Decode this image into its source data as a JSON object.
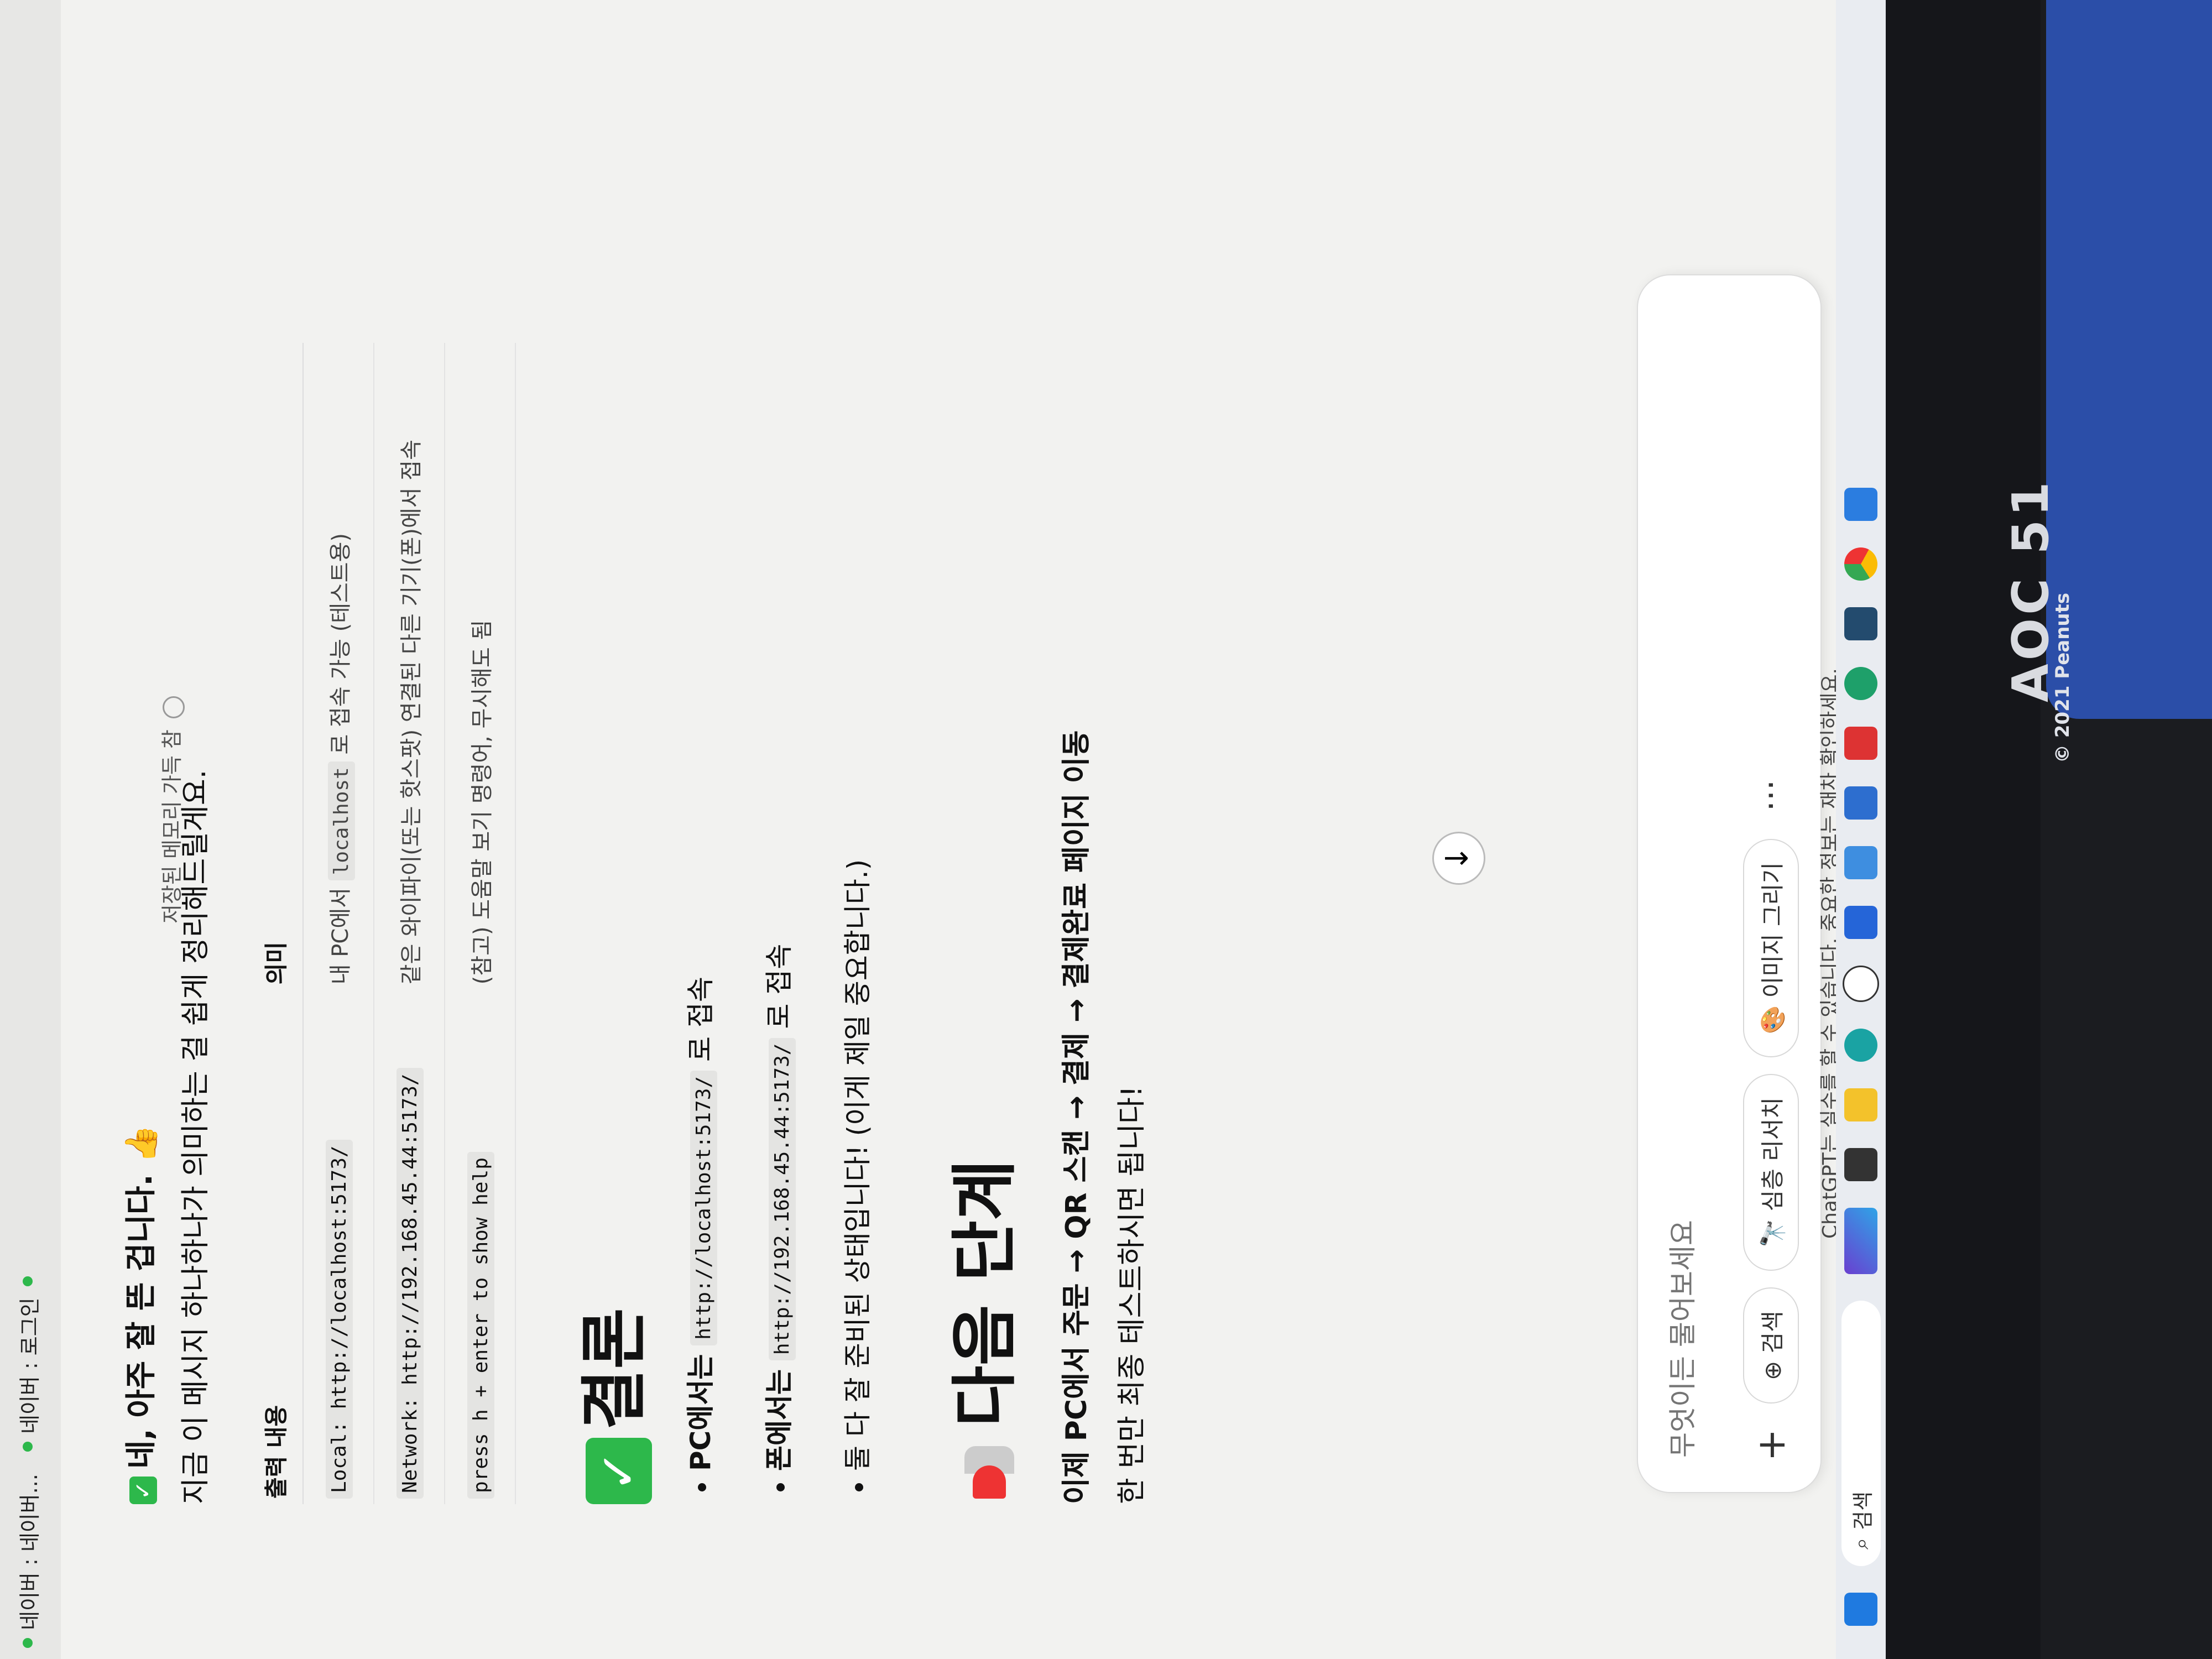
{
  "tabs": [
    {
      "label": "네이버 : 네이버..."
    },
    {
      "label": "네이버 : 로그인"
    }
  ],
  "memory_note": "저장된 메모리 가득 참",
  "message": {
    "intro_heading": "네, 아주 잘 뜬 겁니다. 👍",
    "intro_text": "지금 이 메시지 하나하나가 의미하는 걸 쉽게 정리해드릴게요.",
    "table": {
      "headers": [
        "출력 내용",
        "의미"
      ],
      "rows": [
        {
          "output": "Local: http://localhost:5173/",
          "meaning_prefix": "내 PC에서",
          "meaning_code": "localhost",
          "meaning_suffix": "로 접속 가능 (테스트용)"
        },
        {
          "output": "Network: http://192.168.45.44:5173/",
          "meaning_prefix": "같은 와이파이(또는 핫스팟) 연결된 다른 기기(폰)에서 접속",
          "meaning_code": "",
          "meaning_suffix": ""
        },
        {
          "output": "press h + enter to show help",
          "meaning_prefix": "(참고) 도움말 보기 명령어, 무시해도 됨",
          "meaning_code": "",
          "meaning_suffix": ""
        }
      ]
    },
    "conclusion_title": "결론",
    "bullets": [
      {
        "prefix": "PC에서는",
        "code": "http://localhost:5173/",
        "suffix": "로 접속"
      },
      {
        "prefix": "폰에서는",
        "code": "http://192.168.45.44:5173/",
        "suffix": "로 접속"
      },
      {
        "prefix": "둘 다 잘 준비된 상태입니다! (이게 제일 중요합니다.)",
        "code": "",
        "suffix": ""
      }
    ],
    "next_title": "다음 단계",
    "next_line1": "이제 PC에서 주문 → QR 스캔 → 결제 → 결제완료 페이지 이동",
    "next_line2": "한 번만 최종 테스트하시면 됩니다!"
  },
  "composer": {
    "placeholder": "무엇이든 물어보세요",
    "plus": "+",
    "tools": [
      "⊕ 검색",
      "🔭 심층 리서치",
      "🎨 이미지 그리기"
    ],
    "more": "···"
  },
  "disclaimer": "ChatGPT는 실수를 할 수 있습니다. 중요한 정보는 재차 확인하세요.",
  "taskbar": {
    "search_label": "검색"
  },
  "monitor": {
    "brand": "AOC 51",
    "copyright": "© 2021 Peanuts"
  }
}
